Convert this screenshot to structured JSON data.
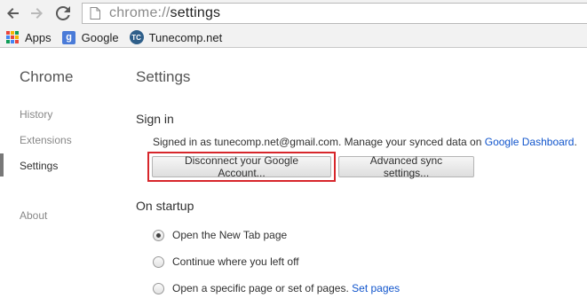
{
  "toolbar": {
    "back_icon": "back-arrow-icon",
    "forward_icon": "forward-arrow-icon",
    "reload_icon": "reload-icon",
    "url_scheme": "chrome://",
    "url_host": "settings"
  },
  "bookmarks": [
    {
      "label": "Apps",
      "icon": "apps-grid-icon"
    },
    {
      "label": "Google",
      "icon": "google-icon"
    },
    {
      "label": "Tunecomp.net",
      "icon": "tunecomp-icon"
    }
  ],
  "sidebar": {
    "brand": "Chrome",
    "items": [
      {
        "label": "History"
      },
      {
        "label": "Extensions"
      },
      {
        "label": "Settings",
        "active": true
      },
      {
        "label": "About"
      }
    ]
  },
  "main": {
    "title": "Settings",
    "sign_in": {
      "heading": "Sign in",
      "status_text": "Signed in as tunecomp.net@gmail.com. Manage your synced data on ",
      "dashboard_link": "Google Dashboard",
      "status_suffix": ".",
      "disconnect_button": "Disconnect your Google Account...",
      "advanced_button": "Advanced sync settings..."
    },
    "on_startup": {
      "heading": "On startup",
      "options": [
        {
          "label": "Open the New Tab page",
          "selected": true
        },
        {
          "label": "Continue where you left off",
          "selected": false
        },
        {
          "label": "Open a specific page or set of pages.",
          "selected": false,
          "link": "Set pages"
        }
      ]
    }
  },
  "colors": {
    "highlight": "#d7262b",
    "link": "#1155cc",
    "chrome_bg": "#f2f2f2"
  }
}
